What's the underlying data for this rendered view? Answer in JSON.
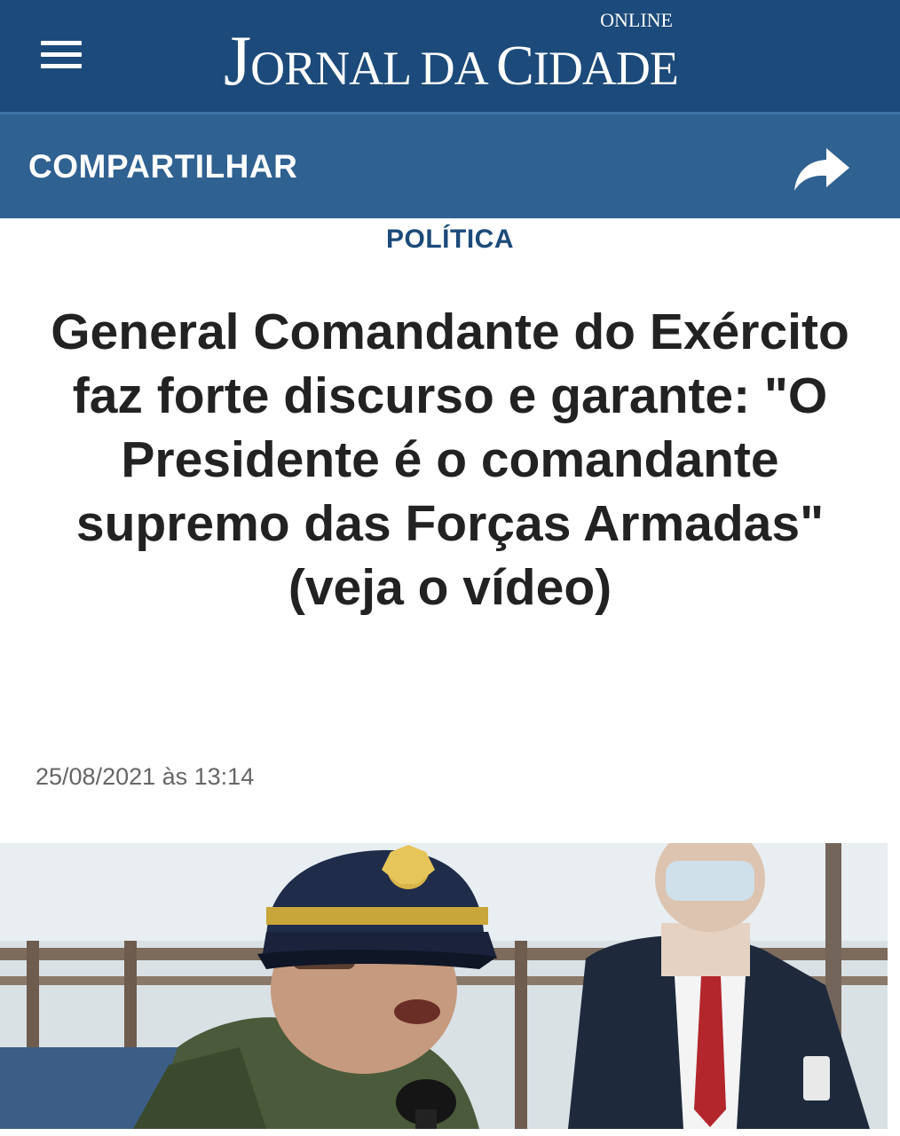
{
  "header": {
    "logo_online": "ONLINE",
    "logo_j": "J",
    "logo_ornal": "ORNAL DA ",
    "logo_c": "C",
    "logo_idade": "IDADE",
    "menu_icon": "hamburger-menu-icon",
    "background_color": "#1c4a7a"
  },
  "share_bar": {
    "label": "COMPARTILHAR",
    "icon": "share-arrow-icon",
    "background_color": "#2f6191"
  },
  "article": {
    "category": "POLÍTICA",
    "headline": "General Comandante do Exército faz forte discurso e garante: \"O Presidente é o comandante supremo das Forças Armadas\" (veja o vídeo)",
    "date": "25/08/2021 às 13:14"
  }
}
